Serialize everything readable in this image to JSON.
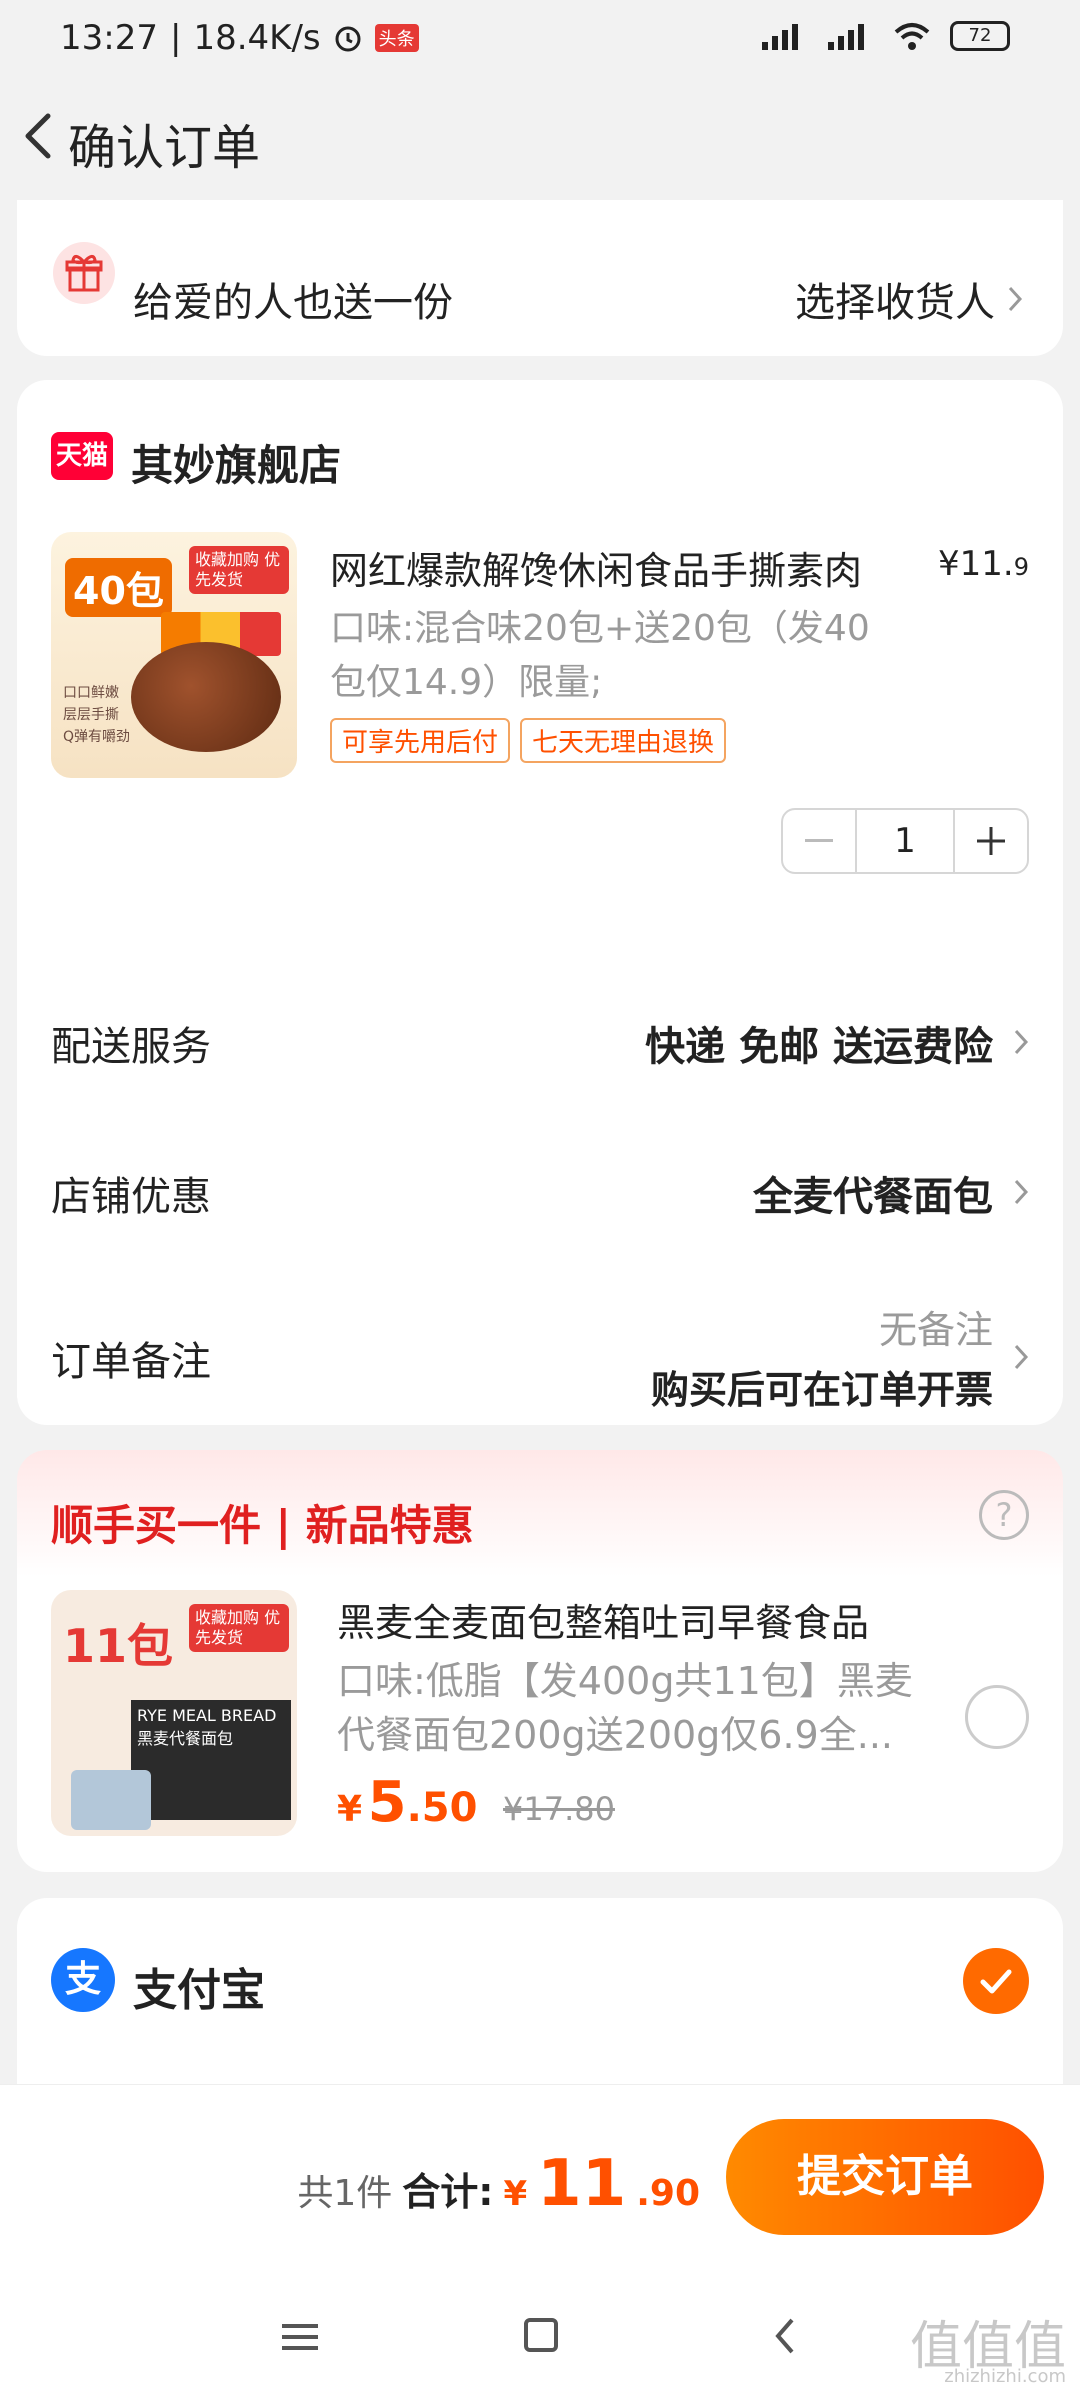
{
  "status_bar": {
    "time": "13:27",
    "speed": "18.4K/s",
    "badge": "头条",
    "battery": "72"
  },
  "header": {
    "title": "确认订单"
  },
  "gift": {
    "text": "给爱的人也送一份",
    "action": "选择收货人"
  },
  "shop": {
    "logo": "天猫",
    "name": "其妙旗舰店",
    "product": {
      "image_label": "40包",
      "image_tag": "收藏加购 优先发货",
      "image_bullets": [
        "口口鲜嫩",
        "层层手撕",
        "Q弹有嚼劲"
      ],
      "title": "网红爆款解馋休闲食品手撕素肉",
      "price_symbol": "¥",
      "price_int": "11.",
      "price_dec": "9",
      "spec": "口味:混合味20包+送20包（发40包仅14.9）限量;",
      "tags": [
        "可享先用后付",
        "七天无理由退换"
      ],
      "quantity": "1"
    },
    "delivery": {
      "label": "配送服务",
      "value": "快递 免邮 送运费险"
    },
    "discount": {
      "label": "店铺优惠",
      "value": "全麦代餐面包"
    },
    "remark": {
      "label": "订单备注",
      "value_top": "无备注",
      "value_bottom": "购买后可在订单开票"
    }
  },
  "promo": {
    "title": "顺手买一件 | 新品特惠",
    "image_label": "11包",
    "image_tag": "收藏加购 优先发货",
    "image_box": "RYE MEAL BREAD 黑麦代餐面包",
    "name": "黑麦全麦面包整箱吐司早餐食品",
    "spec": "口味:低脂【发400g共11包】黑麦代餐面包200g送200g仅6.9全...",
    "price_symbol": "¥",
    "price_int": "5",
    "price_dec": ".50",
    "old_price": "¥17.80"
  },
  "payment": {
    "icon": "支",
    "name": "支付宝"
  },
  "bottom": {
    "count": "共1件",
    "total_label": "合计:",
    "total_symbol": "¥",
    "total_int": "11",
    "total_dec": ".90",
    "submit": "提交订单"
  },
  "watermark": {
    "mark": "值值值",
    "url": "zhizhizhi.com"
  },
  "colors": {
    "accent": "#ff5000",
    "tmall": "#ff0036",
    "alipay": "#1677ff",
    "promo_red": "#e02020"
  }
}
